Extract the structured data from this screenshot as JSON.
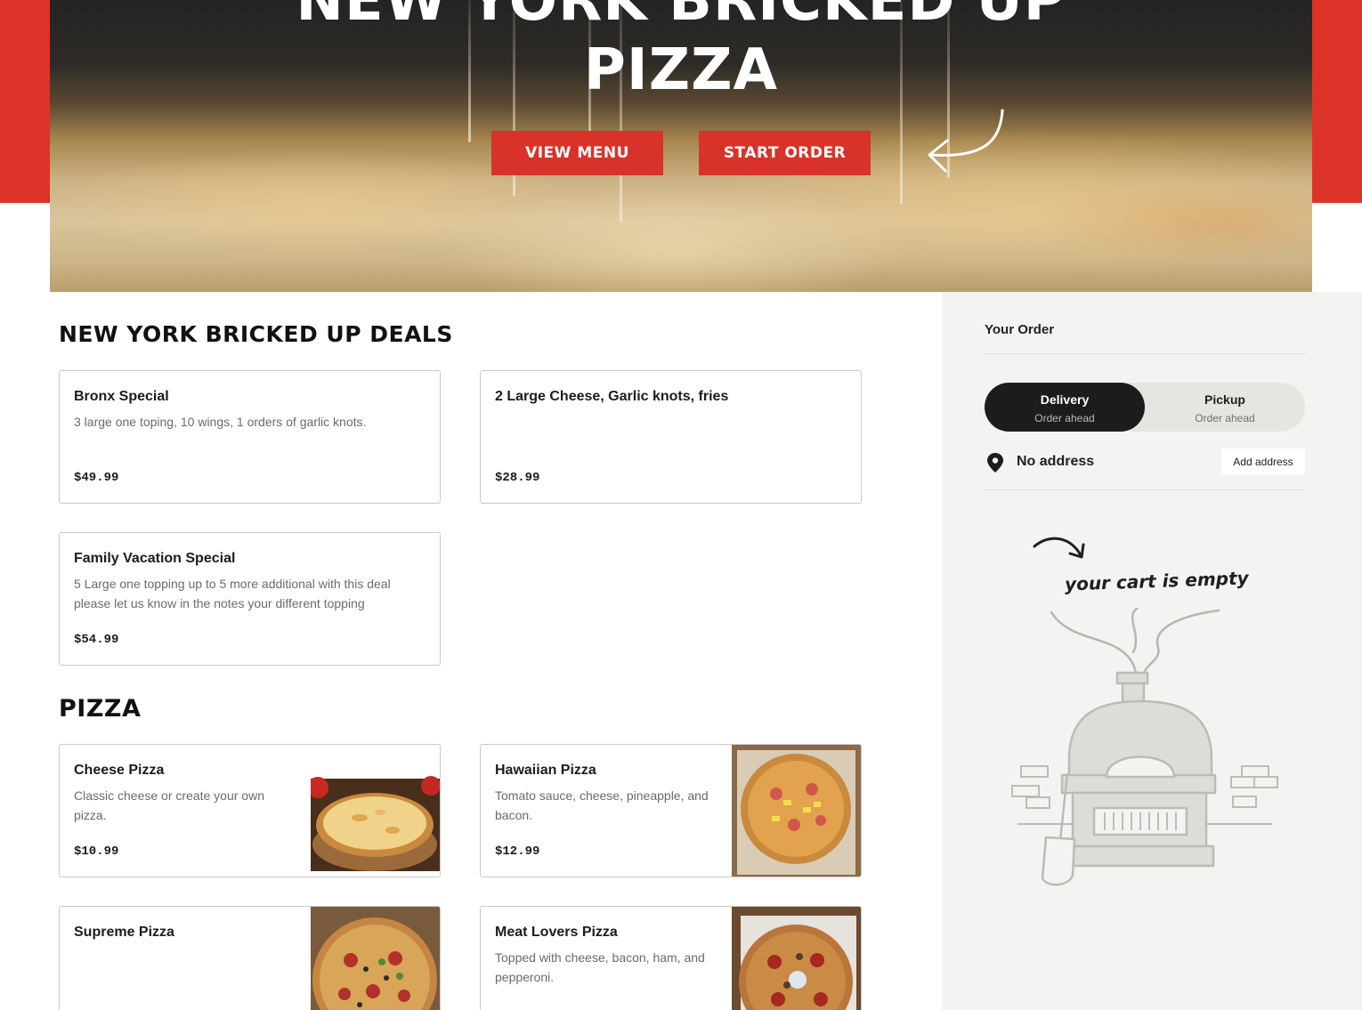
{
  "hero": {
    "title_line1": "NEW YORK BRICKED UP",
    "title_line2": "PIZZA",
    "view_menu_label": "VIEW MENU",
    "start_order_label": "START ORDER"
  },
  "deals_section": {
    "title": "NEW YORK BRICKED UP DEALS",
    "items": [
      {
        "name": "Bronx Special",
        "description": "3 large one toping, 10 wings, 1 orders of garlic knots.",
        "price": "$49.99"
      },
      {
        "name": "2 Large Cheese, Garlic knots, fries",
        "description": "",
        "price": "$28.99"
      },
      {
        "name": "Family Vacation Special",
        "description": "5 Large one topping up to 5 more additional with this deal please let us know in the notes your different topping",
        "price": "$54.99"
      }
    ]
  },
  "pizza_section": {
    "title": "PIZZA",
    "items": [
      {
        "name": "Cheese Pizza",
        "description": "Classic cheese or create your own pizza.",
        "price": "$10.99"
      },
      {
        "name": "Hawaiian Pizza",
        "description": "Tomato sauce, cheese, pineapple, and bacon.",
        "price": "$12.99"
      },
      {
        "name": "Supreme Pizza",
        "description": ""
      },
      {
        "name": "Meat Lovers Pizza",
        "description": "Topped with cheese, bacon, ham, and pepperoni."
      }
    ]
  },
  "order_panel": {
    "title": "Your Order",
    "delivery_label": "Delivery",
    "delivery_sub": "Order ahead",
    "pickup_label": "Pickup",
    "pickup_sub": "Order ahead",
    "address_text": "No address",
    "add_address_label": "Add address",
    "empty_cart_text": "your cart is empty"
  },
  "colors": {
    "brand_red": "#dc3328",
    "dark": "#1c1c1c",
    "sidebar_bg": "#f4f3f1"
  },
  "icons": {
    "hero_arrow": "curved-arrow-icon",
    "address": "location-pin-icon",
    "cart_arrow": "curved-arrow-icon",
    "empty_cart_illustration": "pizza-oven-illustration"
  }
}
